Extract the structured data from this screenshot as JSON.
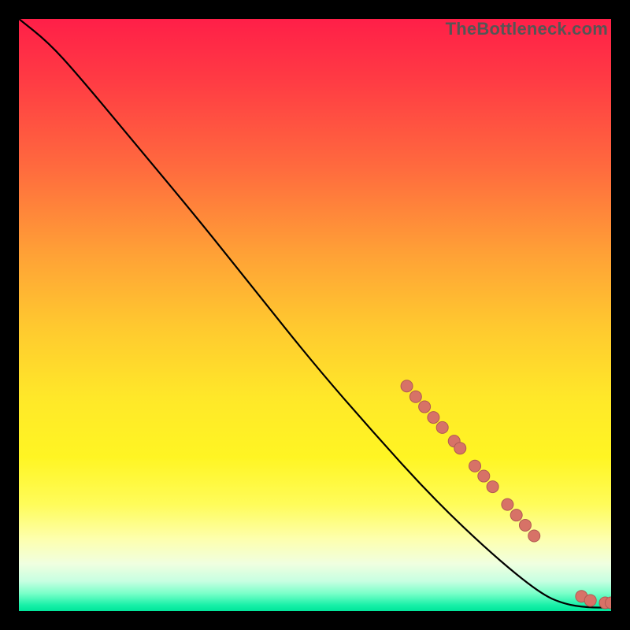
{
  "watermark": "TheBottleneck.com",
  "chart_data": {
    "type": "line",
    "title": "",
    "xlabel": "",
    "ylabel": "",
    "xlim": [
      0,
      100
    ],
    "ylim": [
      0,
      100
    ],
    "grid": false,
    "legend": false,
    "line": [
      {
        "x": 0,
        "y": 100
      },
      {
        "x": 5,
        "y": 96
      },
      {
        "x": 10,
        "y": 90.5
      },
      {
        "x": 20,
        "y": 78.5
      },
      {
        "x": 30,
        "y": 66.5
      },
      {
        "x": 40,
        "y": 54
      },
      {
        "x": 50,
        "y": 41.5
      },
      {
        "x": 60,
        "y": 30
      },
      {
        "x": 70,
        "y": 19
      },
      {
        "x": 80,
        "y": 9.5
      },
      {
        "x": 88,
        "y": 3
      },
      {
        "x": 92,
        "y": 1.2
      },
      {
        "x": 96,
        "y": 0.6
      },
      {
        "x": 100,
        "y": 0.6
      }
    ],
    "markers": [
      {
        "x": 65.5,
        "y": 38.0
      },
      {
        "x": 67.0,
        "y": 36.2
      },
      {
        "x": 68.5,
        "y": 34.5
      },
      {
        "x": 70.0,
        "y": 32.7
      },
      {
        "x": 71.5,
        "y": 31.0
      },
      {
        "x": 73.5,
        "y": 28.7
      },
      {
        "x": 74.5,
        "y": 27.5
      },
      {
        "x": 77.0,
        "y": 24.5
      },
      {
        "x": 78.5,
        "y": 22.8
      },
      {
        "x": 80.0,
        "y": 21.0
      },
      {
        "x": 82.5,
        "y": 18.0
      },
      {
        "x": 84.0,
        "y": 16.2
      },
      {
        "x": 85.5,
        "y": 14.5
      },
      {
        "x": 87.0,
        "y": 12.7
      },
      {
        "x": 95.0,
        "y": 2.5
      },
      {
        "x": 96.5,
        "y": 1.8
      },
      {
        "x": 99.0,
        "y": 1.4
      },
      {
        "x": 100.0,
        "y": 1.4
      }
    ]
  }
}
